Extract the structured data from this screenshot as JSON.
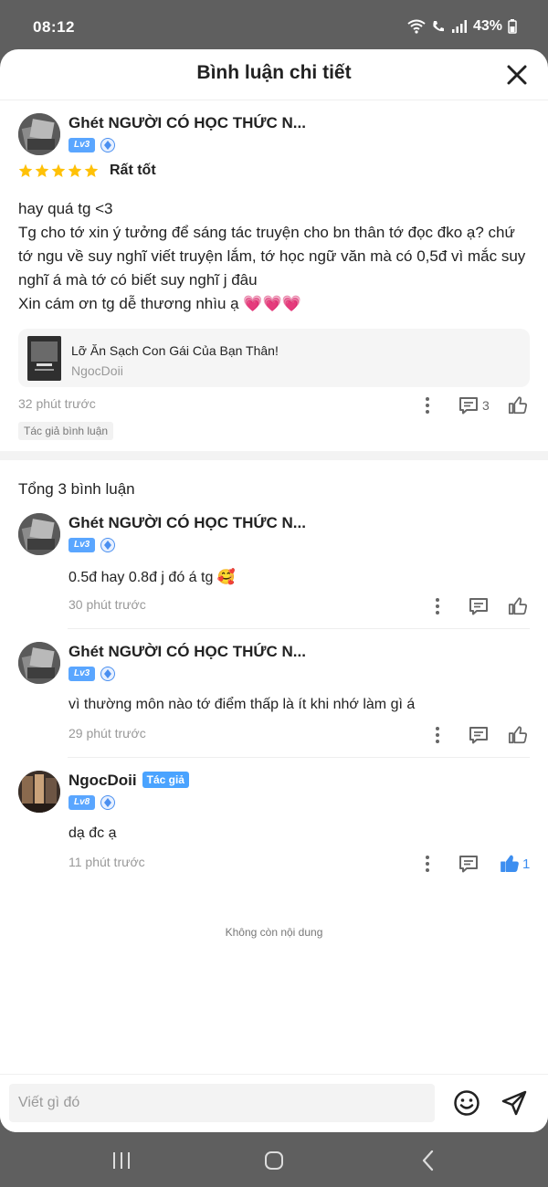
{
  "status_bar": {
    "time": "08:12",
    "battery": "43%"
  },
  "header": {
    "title": "Bình luận chi tiết"
  },
  "main_comment": {
    "user_name": "Ghét NGƯỜI CÓ HỌC THỨC N...",
    "level": "Lv3",
    "rating_label": "Rất tốt",
    "rating_stars": 5,
    "body_lines": [
      "hay quá tg <3",
      "Tg cho tớ xin ý tưởng để sáng tác truyện cho bn thân tớ đọc đko ạ? chứ tớ ngu về suy nghĩ viết truyện lắm, tớ học ngữ văn mà có 0,5đ vì mắc suy nghĩ á mà tớ có biết suy nghĩ j đâu",
      "Xin cám ơn tg dễ thương nhìu ạ 💗💗💗"
    ],
    "book": {
      "title": "Lỡ Ăn Sạch Con Gái Của Bạn Thân!",
      "author": "NgocDoii"
    },
    "time": "32 phút trước",
    "reply_count": "3",
    "author_replied_label": "Tác giả bình luận"
  },
  "total_comments_label": "Tổng 3 bình luận",
  "replies": [
    {
      "user_name": "Ghét NGƯỜI CÓ HỌC THỨC N...",
      "level": "Lv3",
      "text": "0.5đ hay 0.8đ j đó á tg 🥰",
      "time": "30 phút trước"
    },
    {
      "user_name": "Ghét NGƯỜI CÓ HỌC THỨC N...",
      "level": "Lv3",
      "text": "vì thường môn nào tớ điểm thấp là ít khi nhớ làm gì á",
      "time": "29 phút trước"
    },
    {
      "user_name": "NgocDoii",
      "author_tag": "Tác giả",
      "level": "Lv8",
      "text": "dạ đc ạ",
      "time": "11 phút trước",
      "like_count": "1"
    }
  ],
  "end_label": "Không còn nội dung",
  "input": {
    "placeholder": "Viết gì đó"
  },
  "colors": {
    "accent": "#4aa3ff",
    "star": "#ffc107",
    "liked": "#3d8ef0"
  }
}
